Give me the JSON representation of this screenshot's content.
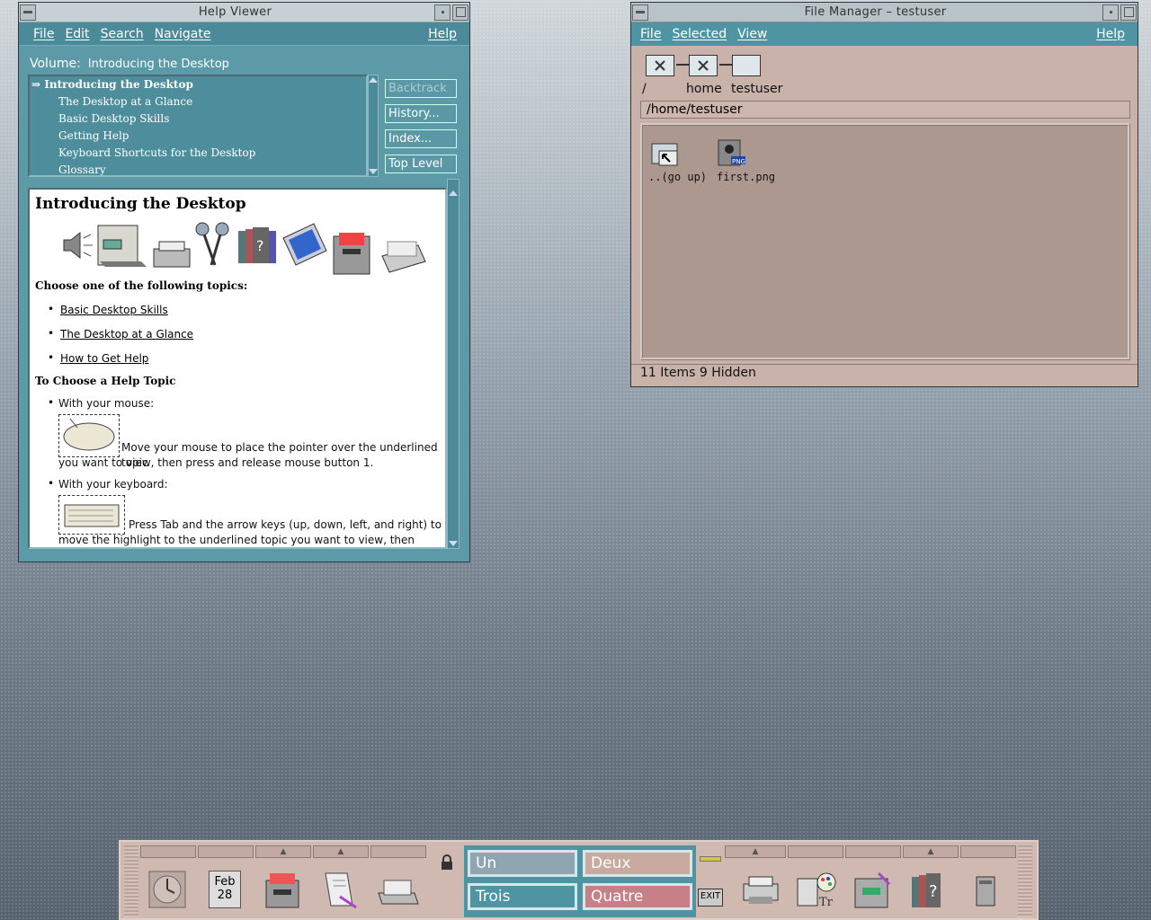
{
  "help_viewer": {
    "title": "Help Viewer",
    "menu": [
      "File",
      "Edit",
      "Search",
      "Navigate"
    ],
    "menu_help": "Help",
    "volume_label": "Volume:",
    "volume_value": "Introducing the Desktop",
    "toc": [
      "Introducing the Desktop",
      "The Desktop at a Glance",
      "Basic Desktop Skills",
      "Getting Help",
      "Keyboard Shortcuts for the Desktop",
      "Glossary"
    ],
    "toc_marker": "⇒",
    "buttons": [
      "Backtrack",
      "History...",
      "Index...",
      "Top Level"
    ],
    "content": {
      "title": "Introducing the Desktop",
      "choose_heading": "Choose one of the following topics:",
      "links": [
        "Basic Desktop Skills",
        "The Desktop at a Glance",
        "How to Get Help"
      ],
      "choose_topic_heading": "To Choose a Help Topic",
      "mouse_label": "With your mouse:",
      "mouse_text_1": "Move your mouse to place the pointer over the underlined topic",
      "mouse_text_2": "you want to view, then press and release mouse button 1.",
      "keyboard_label": "With your keyboard:",
      "keyboard_text_1": "Press Tab and the arrow keys (up, down, left, and right) to",
      "keyboard_text_2": "move the highlight to the underlined topic you want to view, then press"
    }
  },
  "file_manager": {
    "title": "File Manager – testuser",
    "menu": [
      "File",
      "Selected",
      "View"
    ],
    "menu_help": "Help",
    "path_labels": [
      "/",
      "home",
      "testuser"
    ],
    "path_field": "/home/testuser",
    "items": [
      {
        "name": "..(go up)",
        "icon": "folder-up-icon"
      },
      {
        "name": "first.png",
        "icon": "png-file-icon"
      }
    ],
    "status": "11 Items 9 Hidden"
  },
  "front_panel": {
    "calendar_month": "Feb",
    "calendar_day": "28",
    "workspaces": [
      "Un",
      "Deux",
      "Trois",
      "Quatre"
    ],
    "exit_label": "EXIT",
    "colors": {
      "un": "#8fa6b2",
      "deux": "#c8aaa0",
      "trois": "#4e94a3",
      "quatre": "#c77f88"
    }
  }
}
